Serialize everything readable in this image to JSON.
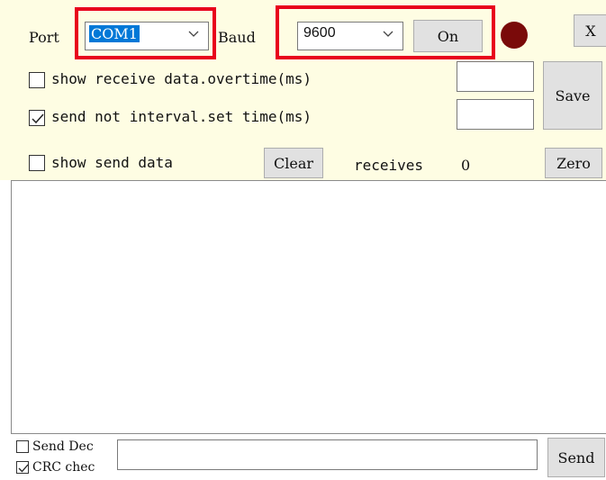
{
  "port": {
    "label": "Port",
    "value": "COM1"
  },
  "baud": {
    "label": "Baud",
    "value": "9600"
  },
  "on_button": "On",
  "close_button": "X",
  "options": {
    "show_receive": {
      "label": "show receive data.overtime(ms)",
      "checked": false
    },
    "send_not_interval": {
      "label": "send not interval.set time(ms)",
      "checked": true
    },
    "show_send": {
      "label": "show send data",
      "checked": false
    }
  },
  "save_button": "Save",
  "clear_button": "Clear",
  "receives": {
    "label": "receives",
    "count": "0"
  },
  "zero_button": "Zero",
  "bottom": {
    "send_dec": {
      "label": "Send Dec",
      "checked": false
    },
    "crc_check": {
      "label": "CRC chec",
      "checked": true
    },
    "send_input": {
      "value": ""
    },
    "send_button": "Send"
  },
  "colors": {
    "panel_bg": "#fefde3",
    "highlight": "#e8001c",
    "led": "#7a0a0a",
    "selection": "#0078d7"
  }
}
